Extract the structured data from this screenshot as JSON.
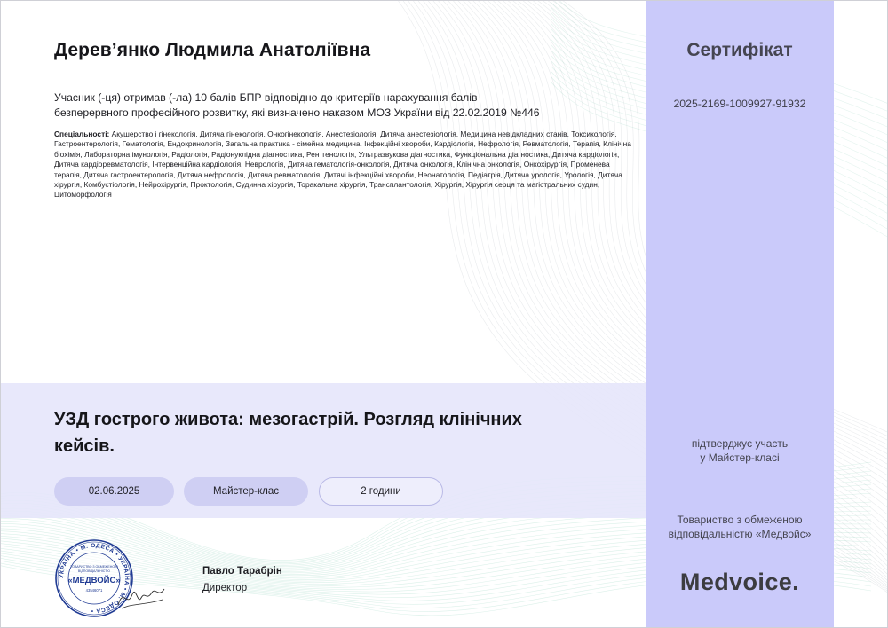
{
  "recipient_name": "Дерев’янко Людмила Анатоліївна",
  "statement_line1": "Учасник (-ця) отримав (-ла) 10 балів БПР відповідно до критеріїв нарахування балів",
  "statement_line2": "безперервного професійного розвитку, які визначено наказом МОЗ України від 22.02.2019 №446",
  "specialties": {
    "label": "Спеціальності:",
    "text": " Акушерство і гінекологія, Дитяча гінекологія, Онкогінекологія, Анестезіологія, Дитяча анестезіологія, Медицина невідкладних станів, Токсикологія, Гастроентерологія, Гематологія, Ендокринологія, Загальна практика - сімейна медицина, Інфекційні хвороби, Кардіологія, Нефрологія, Ревматологія, Терапія, Клінічна біохімія, Лабораторна імунологія, Радіологія, Радіонуклідна діагностика, Рентгенологія, Ультразвукова діагностика, Функціональна діагностика, Дитяча кардіологія, Дитяча кардіоревматологія, Інтервенційна кардіологія, Неврологія, Дитяча гематологія-онкологія, Дитяча онкологія, Клінічна онкологія, Онкохірургія, Променева терапія, Дитяча гастроентерологія, Дитяча нефрологія, Дитяча ревматологія, Дитячі інфекційні хвороби, Неонатологія, Педіатрія, Дитяча урологія, Урологія, Дитяча хірургія, Комбустіологія, Нейрохірургія, Проктологія, Судинна хірургія, Торакальна хірургія, Трансплантологія, Хірургія, Хірургія серця та магістральних судин, Цитоморфологія"
  },
  "course_title_line1": "УЗД гострого живота: мезогастрій. Розгляд клінічних",
  "course_title_line2": "кейсів.",
  "chips": {
    "date": "02.06.2025",
    "format": "Майстер-клас",
    "duration": "2 години"
  },
  "sidebar": {
    "title": "Сертифікат",
    "number": "2025-2169-1009927-91932",
    "confirm_line1": "підтверджує участь",
    "confirm_line2": "у Майстер-класі",
    "company_line1": "Товариство з обмеженою",
    "company_line2": "відповідальністю «Медвойс»",
    "brand": "Medvoice."
  },
  "seal": {
    "center_text": "«МЕДВОЙС»",
    "ring_text": "УКРАЇНА • М. ОДЕСА •",
    "inner_top": "ТОВАРИСТВО З ОБМЕЖЕНОЮ",
    "inner_mid": "ВІДПОВІДАЛЬНІСТЮ",
    "code": "43546071"
  },
  "signer": {
    "name": "Павло Тарабрін",
    "role": "Директор"
  },
  "colors": {
    "band": "#e5e5fb",
    "sidebar": "#cacafa",
    "chip_fill": "#cfcff3",
    "seal_blue": "#1f3a93",
    "wave_green": "#7fc9b0"
  }
}
